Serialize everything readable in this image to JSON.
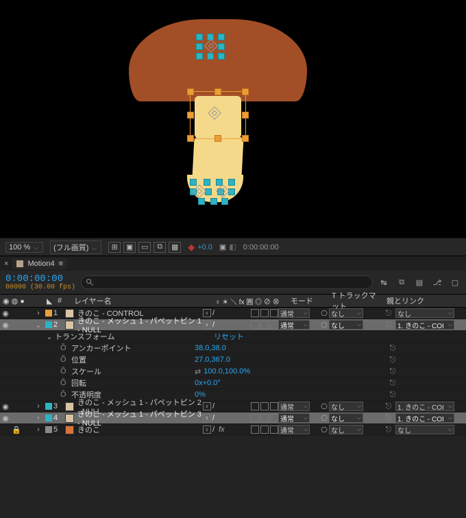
{
  "viewerBar": {
    "zoom": "100 %",
    "quality": "(フル画質)",
    "exposure": "+0.0",
    "previewTime": "0:00:00:00"
  },
  "tab": {
    "title": "Motion4"
  },
  "timelineHeader": {
    "timecode": "0:00:00:00",
    "frameInfo": "00000 (30.00 fps)",
    "searchPlaceholder": ""
  },
  "columns": {
    "num": "#",
    "layerName": "レイヤー名",
    "switches": "♀ ☀ ＼ fx 圓 ◎ ⊘ ⊗",
    "mode": "モード",
    "track": "T  トラックマット",
    "parent": "親とリンク"
  },
  "rows": [
    {
      "idx": "1",
      "color": "chip-o",
      "name": "きのこ - CONTROL",
      "mode": "通常",
      "track": "なし",
      "parent": "なし",
      "fx": ""
    },
    {
      "idx": "2",
      "color": "chip-c",
      "name": "きのこ - メッシュ 1 - パペットピン 1 - NULL",
      "mode": "通常",
      "track": "なし",
      "parent": "1. きのこ - COI",
      "fx": ""
    }
  ],
  "transform": {
    "header": "トランスフォーム",
    "reset": "リセット",
    "props": [
      {
        "label": "アンカーポイント",
        "value": "38.0,38.0"
      },
      {
        "label": "位置",
        "value": "27.0,367.0"
      },
      {
        "label": "スケール",
        "value": "100.0,100.0%",
        "chain": true
      },
      {
        "label": "回転",
        "value": "0x+0.0°"
      },
      {
        "label": "不透明度",
        "value": "0%"
      }
    ]
  },
  "rows2": [
    {
      "idx": "3",
      "color": "chip-c",
      "name": "きのこ - メッシュ 1 - パペットピン 2 - NULL",
      "mode": "通常",
      "track": "なし",
      "parent": "1. きのこ - COI"
    },
    {
      "idx": "4",
      "color": "chip-c",
      "name": "きのこ - メッシュ 1 - パペットピン 3 - NULL",
      "mode": "通常",
      "track": "なし",
      "parent": "1. きのこ - COI"
    },
    {
      "idx": "5",
      "color": "chip-g",
      "name": "きのこ",
      "mode": "通常",
      "track": "なし",
      "parent": "なし",
      "fx": "fx",
      "ai": true,
      "lock": true
    }
  ]
}
